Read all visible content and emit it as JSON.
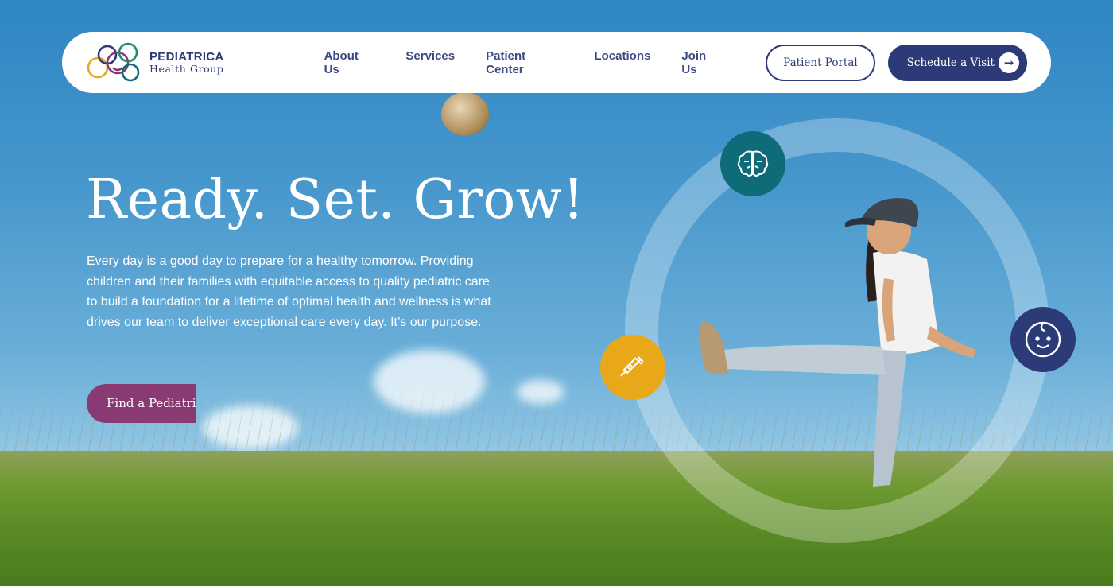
{
  "nav": {
    "logo_name": "PEDIATRICA",
    "logo_sub": "Health Group",
    "links": [
      "About Us",
      "Services",
      "Patient Center",
      "Locations",
      "Join Us"
    ],
    "portal_label": "Patient Portal",
    "visit_label": "Schedule a Visit"
  },
  "hero": {
    "headline": "Ready. Set. Grow!",
    "intro": "Every day is a good day to prepare for a healthy tomorrow. Providing children and their families with equitable access to quality pediatric care to build a foundation for a lifetime of optimal health and wellness is what drives our team to deliver exceptional care every day. It’s our purpose.",
    "find_label": "Find a Pediatrician"
  },
  "icons": {
    "brain": "brain-icon",
    "syringe": "syringe-icon",
    "baby": "baby-face-icon",
    "arrow": "arrow-right-icon"
  },
  "colors": {
    "navy": "#2c3a78",
    "teal": "#0f6b78",
    "amber": "#e8a81a",
    "plum": "#8a3a72"
  }
}
